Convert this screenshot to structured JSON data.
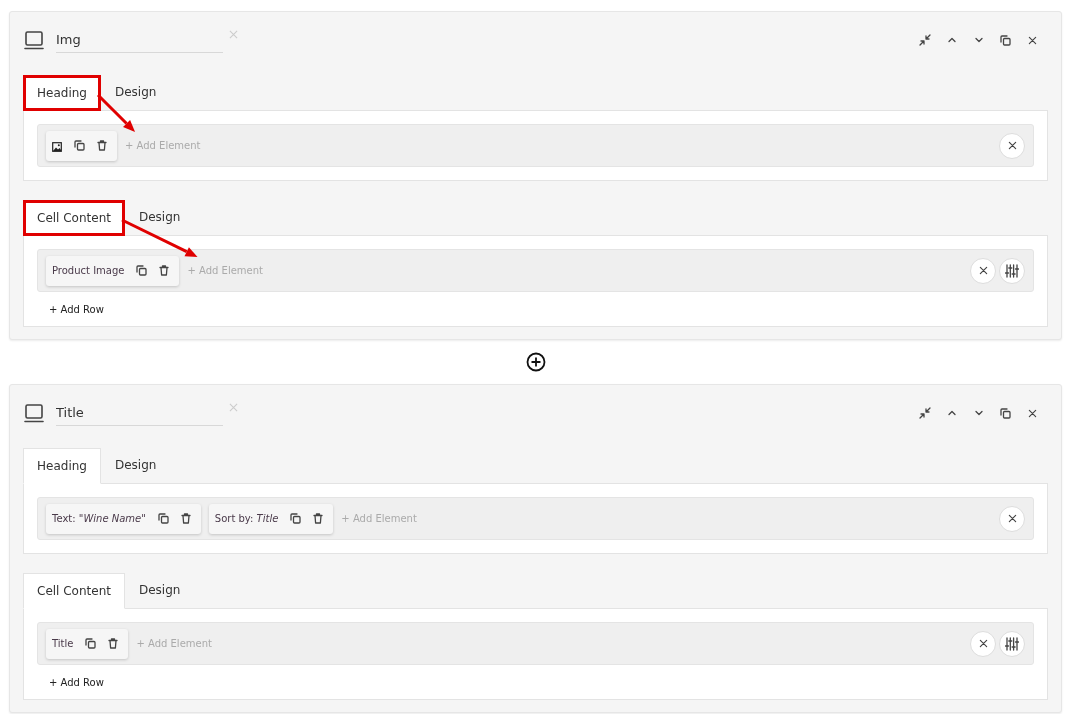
{
  "panels": [
    {
      "name": "Img",
      "sections": [
        {
          "annotated": true,
          "tabs": [
            {
              "label": "Heading",
              "selected": true
            },
            {
              "label": "Design",
              "selected": false
            }
          ],
          "rows": [
            {
              "chips": [
                {
                  "kind": "icon"
                }
              ],
              "add_element": "+ Add Element",
              "actions": [
                {
                  "kind": "close"
                }
              ]
            }
          ]
        },
        {
          "annotated": true,
          "tabs": [
            {
              "label": "Cell Content",
              "selected": true
            },
            {
              "label": "Design",
              "selected": false
            }
          ],
          "rows": [
            {
              "chips": [
                {
                  "kind": "text",
                  "label": "Product Image"
                }
              ],
              "add_element": "+ Add Element",
              "actions": [
                {
                  "kind": "close"
                },
                {
                  "kind": "settings"
                }
              ]
            }
          ],
          "add_row": "+ Add Row"
        }
      ]
    },
    {
      "name": "Title",
      "sections": [
        {
          "annotated": false,
          "tabs": [
            {
              "label": "Heading",
              "selected": true
            },
            {
              "label": "Design",
              "selected": false
            }
          ],
          "rows": [
            {
              "chips": [
                {
                  "kind": "text",
                  "label": "Text: *\"Wine Name\"*"
                },
                {
                  "kind": "text",
                  "label": "Sort by: *Title*"
                }
              ],
              "add_element": "+ Add Element",
              "actions": [
                {
                  "kind": "close"
                }
              ]
            }
          ]
        },
        {
          "annotated": false,
          "tabs": [
            {
              "label": "Cell Content",
              "selected": true
            },
            {
              "label": "Design",
              "selected": false
            }
          ],
          "rows": [
            {
              "chips": [
                {
                  "kind": "text",
                  "label": "Title"
                }
              ],
              "add_element": "+ Add Element",
              "actions": [
                {
                  "kind": "close"
                },
                {
                  "kind": "settings"
                }
              ]
            }
          ],
          "add_row": "+ Add Row"
        }
      ]
    }
  ]
}
